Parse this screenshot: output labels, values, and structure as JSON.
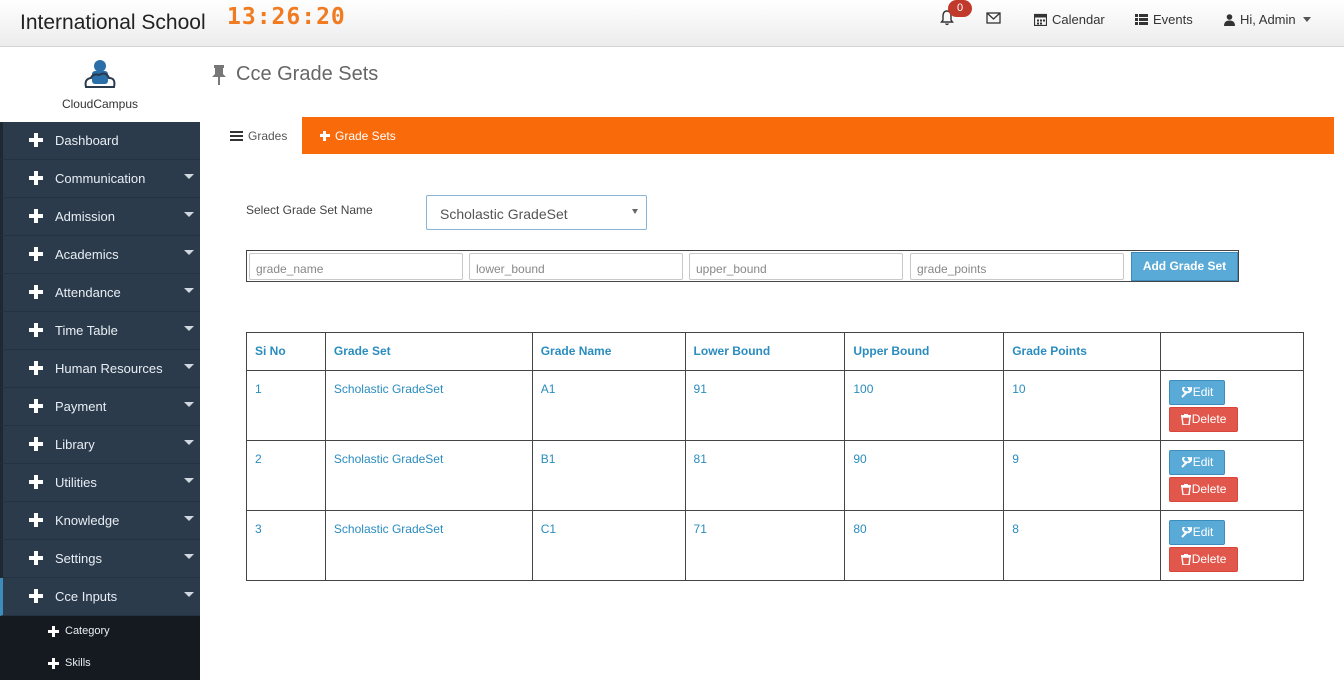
{
  "header": {
    "school_name": "International School",
    "clock": "13:26:20",
    "notification_count": "0",
    "calendar_label": "Calendar",
    "events_label": "Events",
    "user_label": "Hi, Admin"
  },
  "logo": {
    "text": "CloudCampus"
  },
  "sidebar": {
    "items": [
      {
        "label": "Dashboard",
        "caret": false
      },
      {
        "label": "Communication",
        "caret": true
      },
      {
        "label": "Admission",
        "caret": true
      },
      {
        "label": "Academics",
        "caret": true
      },
      {
        "label": "Attendance",
        "caret": true
      },
      {
        "label": "Time Table",
        "caret": true
      },
      {
        "label": "Human Resources",
        "caret": true
      },
      {
        "label": "Payment",
        "caret": true
      },
      {
        "label": "Library",
        "caret": true
      },
      {
        "label": "Utilities",
        "caret": true
      },
      {
        "label": "Knowledge",
        "caret": true
      },
      {
        "label": "Settings",
        "caret": true
      },
      {
        "label": "Cce Inputs",
        "caret": true
      }
    ],
    "sub_items": [
      {
        "label": "Category"
      },
      {
        "label": "Skills"
      }
    ]
  },
  "page": {
    "title": "Cce Grade Sets"
  },
  "tabs": {
    "grades": "Grades",
    "grade_sets": "Grade Sets"
  },
  "form": {
    "select_label": "Select Grade Set Name",
    "select_value": "Scholastic GradeSet",
    "grade_name_placeholder": "grade_name",
    "lower_bound_placeholder": "lower_bound",
    "upper_bound_placeholder": "upper_bound",
    "grade_points_placeholder": "grade_points",
    "add_button": "Add Grade Set"
  },
  "table": {
    "headers": [
      "Si No",
      "Grade Set",
      "Grade Name",
      "Lower Bound",
      "Upper Bound",
      "Grade Points",
      ""
    ],
    "rows": [
      [
        "1",
        "Scholastic GradeSet",
        "A1",
        "91",
        "100",
        "10"
      ],
      [
        "2",
        "Scholastic GradeSet",
        "B1",
        "81",
        "90",
        "9"
      ],
      [
        "3",
        "Scholastic GradeSet",
        "C1",
        "71",
        "80",
        "8"
      ]
    ],
    "edit_label": "Edit",
    "delete_label": "Delete"
  },
  "colors": {
    "accent_orange": "#f96a0a",
    "clock_orange": "#f07b20",
    "sidebar_bg": "#2c3b4c",
    "link_blue": "#2a8cbf",
    "edit_blue": "#5aaad8",
    "delete_red": "#e2574c",
    "badge_red": "#c0392b"
  }
}
